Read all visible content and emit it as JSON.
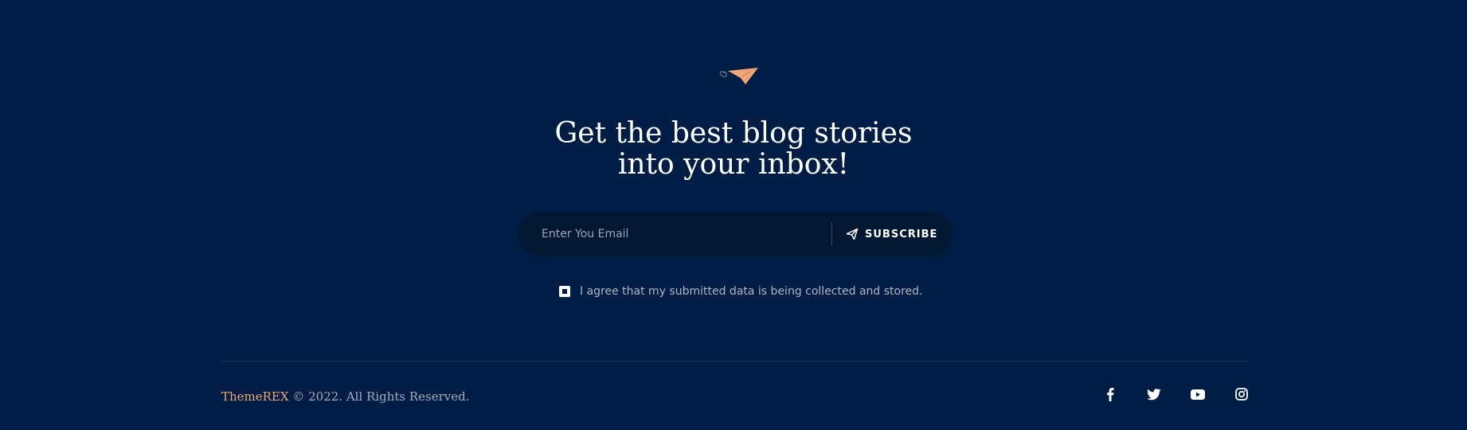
{
  "newsletter": {
    "heading_line1": "Get the best blog stories",
    "heading_line2": "into your inbox!",
    "email_placeholder": "Enter You Email",
    "email_value": "",
    "subscribe_label": "SUBSCRIBE",
    "consent_text": "I agree that my submitted data is being collected and stored.",
    "consent_checked": true,
    "icon": "paper-plane-icon"
  },
  "footer": {
    "brand": "ThemeREX",
    "copyright": " © 2022. All Rights Reserved.",
    "socials": [
      {
        "name": "facebook-icon"
      },
      {
        "name": "twitter-icon"
      },
      {
        "name": "youtube-icon"
      },
      {
        "name": "instagram-icon"
      }
    ]
  },
  "colors": {
    "background": "#001e45",
    "form_background": "#011833",
    "accent": "#f0a677",
    "text_muted": "#aeb6c4"
  }
}
